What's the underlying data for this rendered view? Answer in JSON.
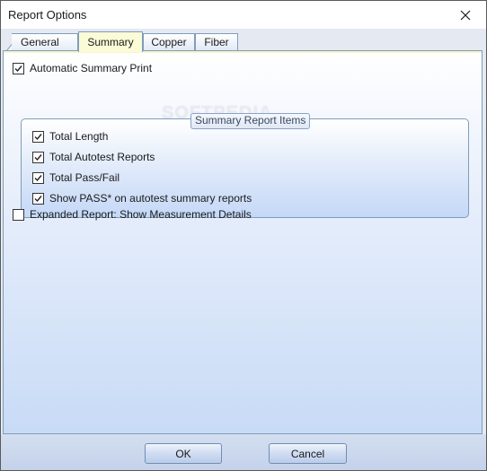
{
  "window": {
    "title": "Report Options"
  },
  "tabs": [
    {
      "label": "General",
      "active": false
    },
    {
      "label": "Summary",
      "active": true
    },
    {
      "label": "Copper",
      "active": false
    },
    {
      "label": "Fiber",
      "active": false
    }
  ],
  "summary": {
    "automatic_summary_print": {
      "label": "Automatic Summary Print",
      "checked": true
    },
    "group": {
      "title": "Summary Report Items",
      "items": [
        {
          "label": "Total Length",
          "checked": true
        },
        {
          "label": "Total Autotest Reports",
          "checked": true
        },
        {
          "label": "Total Pass/Fail",
          "checked": true
        },
        {
          "label": "Show PASS* on autotest summary reports",
          "checked": true
        }
      ]
    },
    "expanded_report": {
      "label": "Expanded Report: Show Measurement Details",
      "checked": false
    }
  },
  "watermark": "SOFTPEDIA",
  "buttons": {
    "ok": "OK",
    "cancel": "Cancel"
  },
  "colors": {
    "active_tab": "#fbfbd7",
    "border_accent": "#7f9db9",
    "panel_gradient_bottom": "#c8dbf6"
  },
  "icons": {
    "close": "close-icon",
    "check": "checkmark-icon"
  }
}
